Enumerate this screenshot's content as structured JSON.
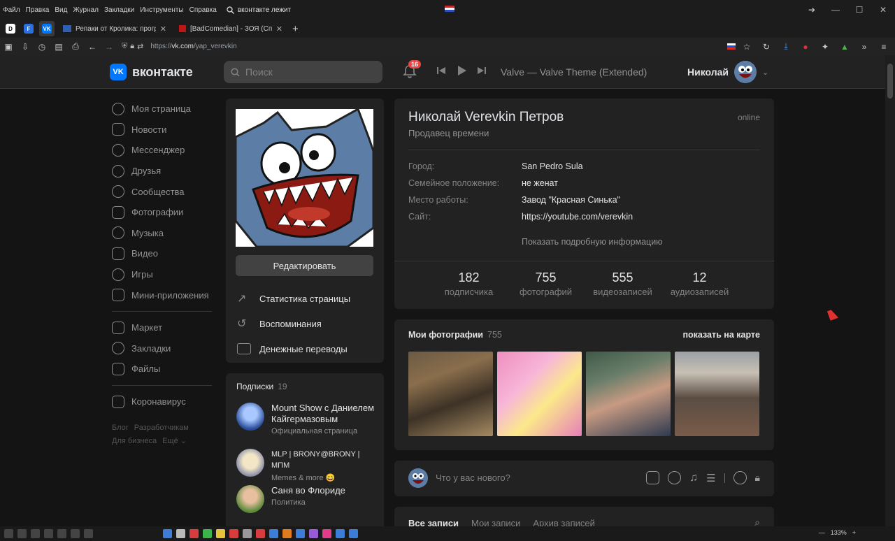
{
  "browser": {
    "menu": [
      "Файл",
      "Правка",
      "Вид",
      "Журнал",
      "Закладки",
      "Инструменты",
      "Справка"
    ],
    "search_text": "вконтакте лежит",
    "tabs": [
      {
        "title": "Репаки от Кролика: програм"
      },
      {
        "title": "[BadComedian] - ЗОЯ (Спасен"
      }
    ],
    "url_prefix": "https://",
    "url_host": "vk.com",
    "url_path": "/yap_verevkin",
    "zoom": "133%"
  },
  "header": {
    "logo_text": "вконтакте",
    "logo_mark": "VK",
    "search_placeholder": "Поиск",
    "notif_count": "16",
    "track": "Valve — Valve Theme (Extended)",
    "user_name": "Николай"
  },
  "leftnav": {
    "items": [
      "Моя страница",
      "Новости",
      "Мессенджер",
      "Друзья",
      "Сообщества",
      "Фотографии",
      "Музыка",
      "Видео",
      "Игры",
      "Мини-приложения"
    ],
    "items2": [
      "Маркет",
      "Закладки",
      "Файлы"
    ],
    "items3": [
      "Коронавирус"
    ],
    "footer": [
      "Блог",
      "Разработчикам",
      "Для бизнеса",
      "Ещё ⌄"
    ]
  },
  "profile": {
    "edit_label": "Редактировать",
    "actions": [
      "Статистика страницы",
      "Воспоминания",
      "Денежные переводы"
    ],
    "name": "Николай Verevkin Петров",
    "status": "Продавец времени",
    "online": "online",
    "info": [
      {
        "label": "Город:",
        "value": "San Pedro Sula"
      },
      {
        "label": "Семейное положение:",
        "value": "не женат"
      },
      {
        "label": "Место работы:",
        "value": "Завод \"Красная Синька\""
      },
      {
        "label": "Сайт:",
        "value": "https://youtube.com/verevkin"
      }
    ],
    "more_info": "Показать подробную информацию",
    "counters": [
      {
        "n": "182",
        "l": "подписчика"
      },
      {
        "n": "755",
        "l": "фотографий"
      },
      {
        "n": "555",
        "l": "видеозаписей"
      },
      {
        "n": "12",
        "l": "аудиозаписей"
      }
    ]
  },
  "subs": {
    "title": "Подписки",
    "count": "19",
    "items": [
      {
        "name": "Mount Show с Даниелем Кайгермазовым",
        "desc": "Официальная страница"
      },
      {
        "name": "MLP | BRONY@BRONY | МПМ",
        "desc": "Memes & more 😄"
      },
      {
        "name": "Саня во Флориде",
        "desc": "Политика"
      }
    ]
  },
  "photos": {
    "title": "Мои фотографии",
    "count": "755",
    "map_link": "показать на карте"
  },
  "postbox": {
    "placeholder": "Что у вас нового?"
  },
  "wall": {
    "tabs": [
      "Все записи",
      "Мои записи",
      "Архив записей"
    ]
  }
}
